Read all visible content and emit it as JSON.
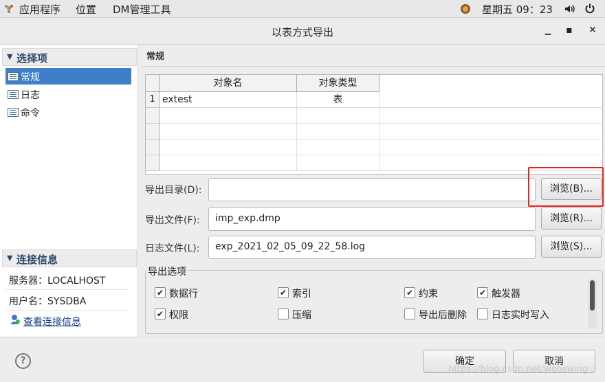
{
  "topbar": {
    "apps": "应用程序",
    "places": "位置",
    "dm_tool": "DM管理工具",
    "clock": "星期五 09：23"
  },
  "window": {
    "title": "以表方式导出",
    "minimize": "▁",
    "maximize": "▪",
    "close": "✕"
  },
  "sidebar": {
    "section_title": "选择项",
    "items": [
      {
        "label": "常规",
        "selected": true
      },
      {
        "label": "日志",
        "selected": false
      },
      {
        "label": "命令",
        "selected": false
      }
    ],
    "conn_title": "连接信息",
    "server": "服务器：LOCALHOST",
    "user": "用户名：SYSDBA",
    "view_conn": "查看连接信息"
  },
  "main": {
    "section": "常规",
    "grid": {
      "columns": [
        "对象名",
        "对象类型"
      ],
      "rows": [
        {
          "num": "1",
          "name": "extest",
          "type": "表"
        }
      ]
    },
    "export_dir": {
      "label": "导出目录(D):",
      "value": "",
      "button": "浏览(B)..."
    },
    "export_file": {
      "label": "导出文件(F):",
      "value": "imp_exp.dmp",
      "button": "浏览(R)..."
    },
    "log_file": {
      "label": "日志文件(L):",
      "value": "exp_2021_02_05_09_22_58.log",
      "button": "浏览(S)..."
    },
    "options": {
      "title": "导出选项",
      "items": [
        {
          "label": "数据行",
          "checked": true
        },
        {
          "label": "索引",
          "checked": true
        },
        {
          "label": "约束",
          "checked": true
        },
        {
          "label": "触发器",
          "checked": true
        },
        {
          "label": "权限",
          "checked": true
        },
        {
          "label": "压缩",
          "checked": false
        },
        {
          "label": "导出后删除",
          "checked": false
        },
        {
          "label": "日志实时写入",
          "checked": false
        }
      ]
    }
  },
  "footer": {
    "help": "?",
    "ok": "确定",
    "cancel": "取消",
    "watermark": "https://blog.csdn.net/wooswing"
  },
  "colors": {
    "accent": "#3f7ec8",
    "highlight": "#e52222"
  }
}
